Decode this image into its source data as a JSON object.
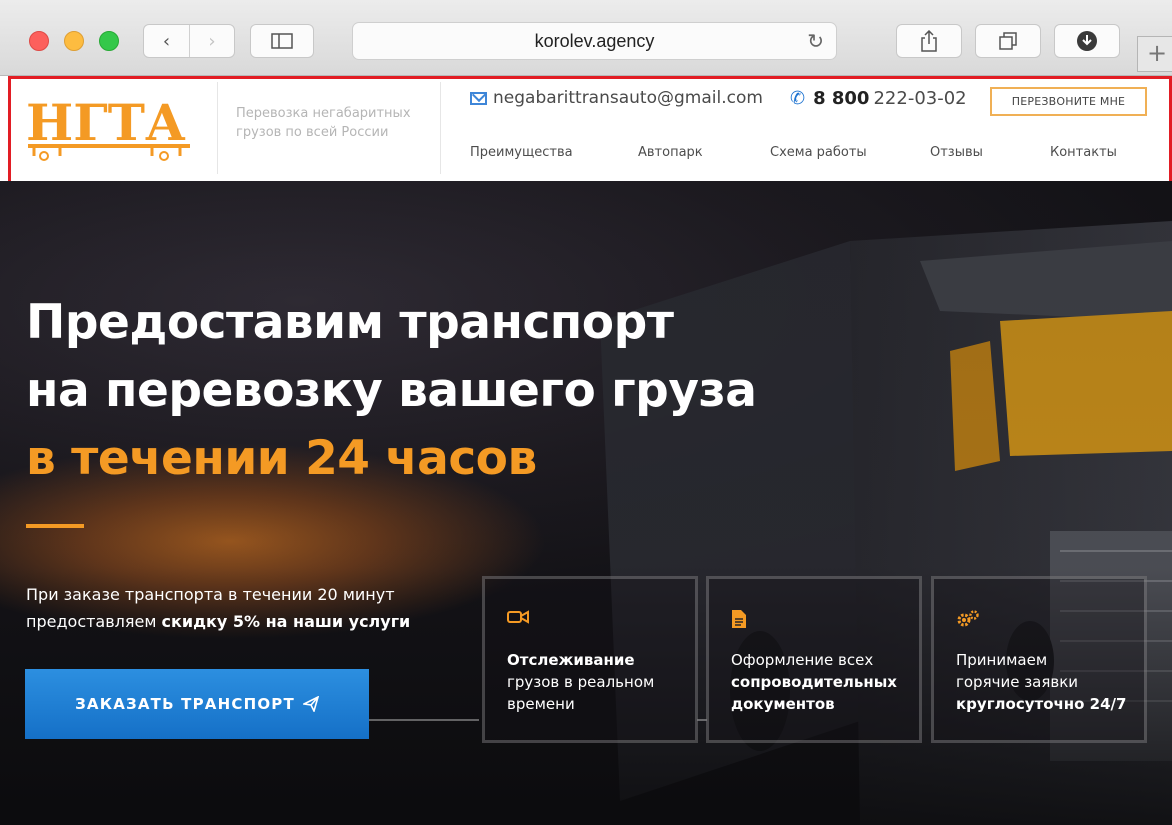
{
  "browser": {
    "url": "korolev.agency",
    "back_icon": "‹",
    "forward_icon": "›",
    "new_tab_icon": "+"
  },
  "header": {
    "logo_text": "НГТА",
    "tagline_line1": "Перевозка негабаритных",
    "tagline_line2": "грузов по всей России",
    "email": "negabarittransauto@gmail.com",
    "phone_prefix": "8 800",
    "phone_number": "222-03-02",
    "callback_label": "ПЕРЕЗВОНИТЕ МНЕ",
    "nav": [
      "Преимущества",
      "Автопарк",
      "Схема работы",
      "Отзывы",
      "Контакты"
    ]
  },
  "hero": {
    "headline_line1": "Предоставим транспорт",
    "headline_line2": "на перевозку вашего груза",
    "headline_line3": "в течении 24 часов",
    "offer_line1": "При заказе транспорта в течении 20 минут",
    "offer_line2_plain": "предоставляем ",
    "offer_line2_bold": "скидку 5% на наши услуги",
    "order_button": "ЗАКАЗАТЬ ТРАНСПОРТ",
    "features": [
      {
        "icon": "video-camera-icon",
        "bold": "Отслеживание",
        "rest1": "грузов в реальном",
        "rest2": "времени"
      },
      {
        "icon": "document-icon",
        "plain": "Оформление всех",
        "bold1": "сопроводительных",
        "bold2": "документов"
      },
      {
        "icon": "gears-icon",
        "plain1": "Принимаем",
        "plain2": "горячие заявки",
        "bold": "круглосуточно 24/7"
      }
    ]
  },
  "colors": {
    "accent_orange": "#f49a24",
    "button_blue": "#1f7fd6",
    "highlight_red": "#e21d24"
  }
}
